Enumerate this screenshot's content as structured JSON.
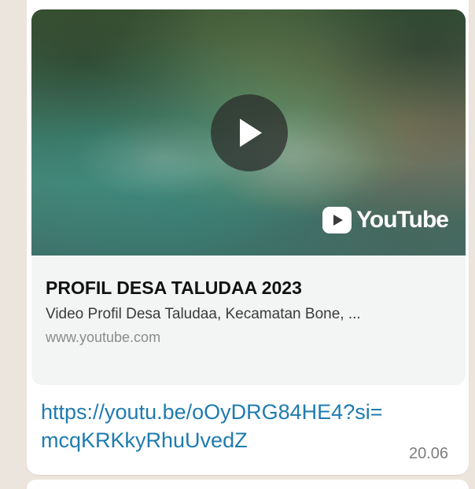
{
  "link_preview": {
    "title": "PROFIL DESA TALUDAA 2023",
    "description": "Video Profil Desa Taludaa, Kecamatan Bone, ...",
    "domain": "www.youtube.com",
    "brand_text": "YouTube",
    "play_icon": "play-icon",
    "youtube_icon": "youtube-play-icon"
  },
  "message": {
    "url_line1": "https://youtu.be/oOyDRG84HE4?si=",
    "url_line2": "mcqKRKkyRhuUvedZ",
    "time": "20.06"
  },
  "colors": {
    "link": "#1f7bb0",
    "bubble": "#ffffff",
    "preview_bg": "#f3f4f4",
    "wallpaper": "#ece5dd"
  }
}
